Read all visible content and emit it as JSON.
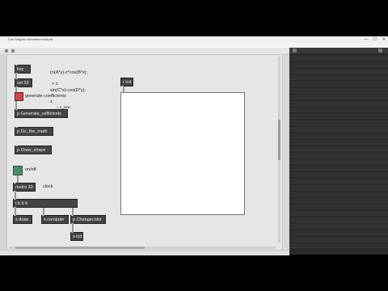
{
  "window": {
    "title": "Cos Shapes Generator.maxpat",
    "controls": {
      "minimize": "—",
      "maximize": "☐",
      "close": "✕"
    }
  },
  "menu": [
    "File",
    "Edit",
    "View",
    "Object",
    "Arrange",
    "Options",
    "Debug",
    "Extras",
    "Window",
    "Help"
  ],
  "patch": {
    "objects": {
      "key": "key",
      "sel": "sel 32",
      "generate": "p Generate_cefficients",
      "do_math": "p Do_the_math",
      "draw_shape": "p Draw_shape",
      "metro": "metro 33",
      "tbbb": "t b b b",
      "s_draw": "s draw",
      "s_compute": "s compute",
      "changecolor": "p Changecolor",
      "s_lcd": "s lcd",
      "r_lcd": "r lcd"
    },
    "comments": {
      "formula1": "(n(A*y)-z*cos(B*x);",
      "formula_arrow": "> z",
      "formula2": "sin(C*x)-cos(D*y);",
      "generate_label": "generate coefficients",
      "z": "z",
      "x_new": "= x_new",
      "onoff": "on/off",
      "clock": "clock"
    }
  },
  "colors": {
    "bang": "#c44848",
    "toggle": "#4f8a6a",
    "object_box": "#444444",
    "canvas": "#e6e6e6",
    "lcd": "#ffffff",
    "sidebar": "#2b2b2b"
  }
}
